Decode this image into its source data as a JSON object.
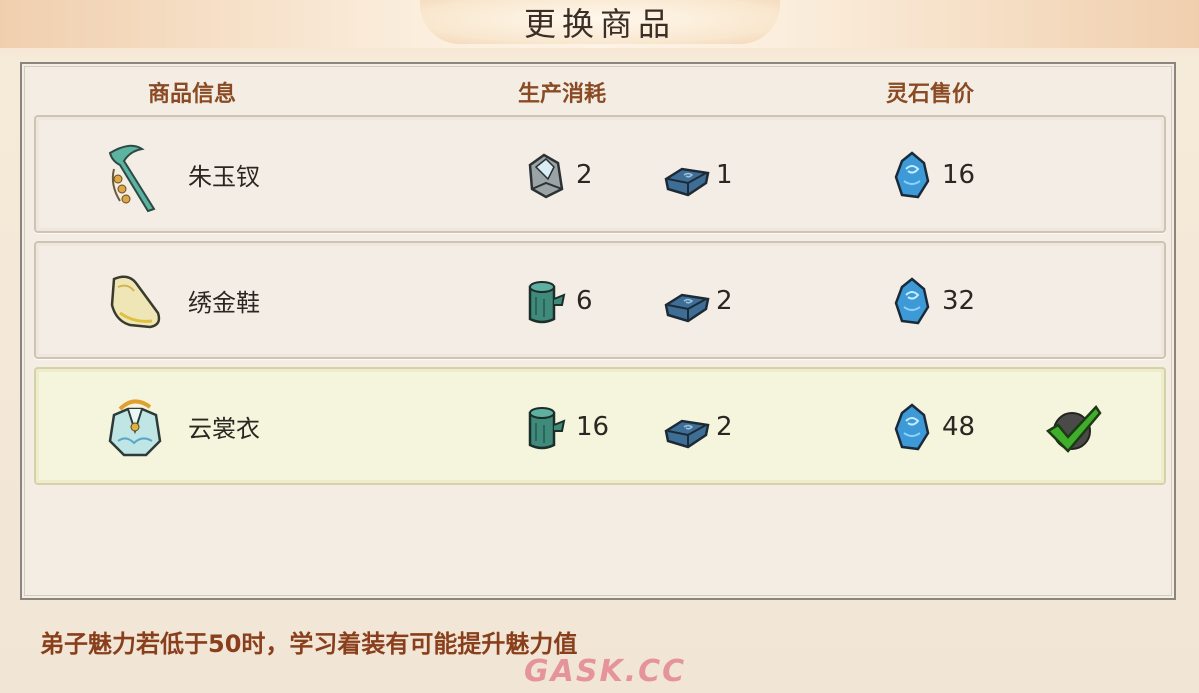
{
  "title": "更换商品",
  "headers": {
    "info": "商品信息",
    "cost": "生产消耗",
    "price": "灵石售价"
  },
  "rows": [
    {
      "name": "朱玉钗",
      "icon": "jade-hairpin-icon",
      "cost1_icon": "crystal-ore-icon",
      "cost1": "2",
      "cost2_icon": "iron-ingot-icon",
      "cost2": "1",
      "price_icon": "spirit-stone-icon",
      "price": "16",
      "selected": false
    },
    {
      "name": "绣金鞋",
      "icon": "embroidered-shoe-icon",
      "cost1_icon": "wood-log-icon",
      "cost1": "6",
      "cost2_icon": "iron-ingot-icon",
      "cost2": "2",
      "price_icon": "spirit-stone-icon",
      "price": "32",
      "selected": false
    },
    {
      "name": "云裳衣",
      "icon": "cloud-robe-icon",
      "cost1_icon": "wood-log-icon",
      "cost1": "16",
      "cost2_icon": "iron-ingot-icon",
      "cost2": "2",
      "price_icon": "spirit-stone-icon",
      "price": "48",
      "selected": true
    }
  ],
  "hint": "弟子魅力若低于50时，学习着装有可能提升魅力值",
  "watermark": "GASK.CC",
  "colors": {
    "header": "#8a4a24",
    "selected_row": "#f5f4dc",
    "check": "#3fae2a"
  }
}
